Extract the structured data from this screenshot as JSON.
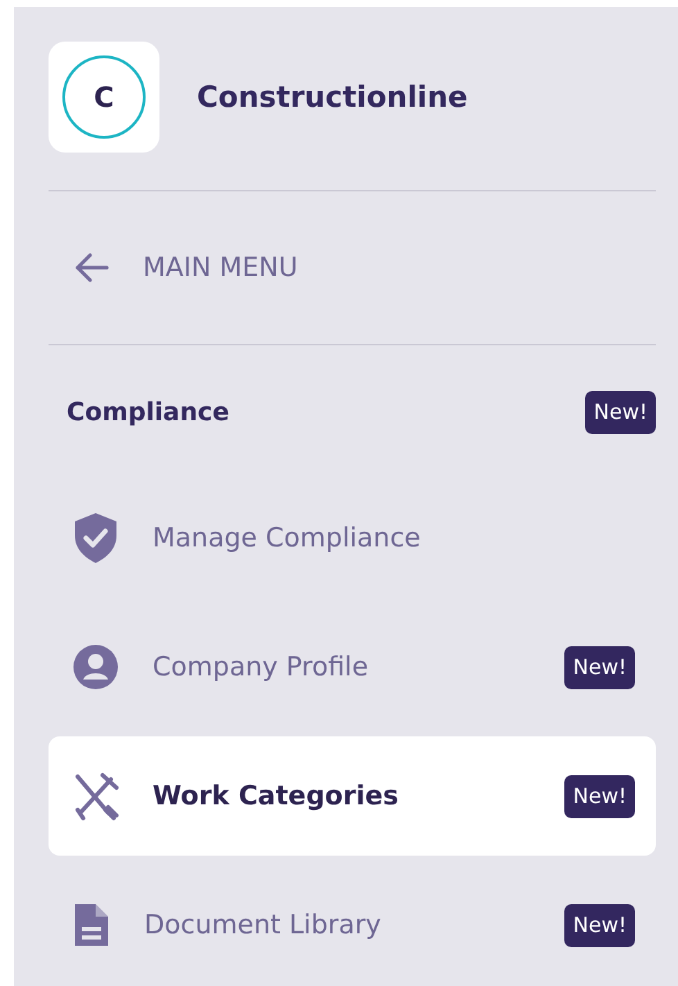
{
  "brand": {
    "logo_letter": "C",
    "name": "Constructionline"
  },
  "back_link": {
    "label": "MAIN MENU"
  },
  "section": {
    "title": "Compliance",
    "badge": "New!"
  },
  "items": [
    {
      "kind": "shield",
      "label": "Manage Compliance",
      "selected": false
    },
    {
      "kind": "person",
      "label": "Company Profile",
      "badge": "New!",
      "selected": false
    },
    {
      "kind": "tools",
      "label": "Work Categories",
      "badge": "New!",
      "selected": true
    },
    {
      "kind": "document",
      "label": "Document Library",
      "badge": "New!",
      "selected": false
    }
  ]
}
